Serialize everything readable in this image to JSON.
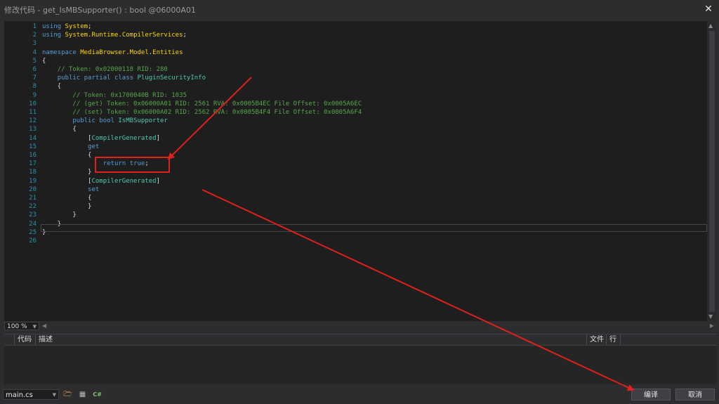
{
  "window": {
    "title": "修改代码 - get_IsMBSupporter() : bool @06000A01",
    "close_label": "✕"
  },
  "editor": {
    "lines": [
      {
        "num": "1",
        "parts": [
          [
            "kw",
            "using"
          ],
          [
            "plain",
            " "
          ],
          [
            "nm",
            "System"
          ],
          [
            "plain",
            ";"
          ]
        ]
      },
      {
        "num": "2",
        "parts": [
          [
            "kw",
            "using"
          ],
          [
            "plain",
            " "
          ],
          [
            "nm",
            "System"
          ],
          [
            "plain",
            "."
          ],
          [
            "nm",
            "Runtime"
          ],
          [
            "plain",
            "."
          ],
          [
            "nm",
            "CompilerServices"
          ],
          [
            "plain",
            ";"
          ]
        ]
      },
      {
        "num": "3",
        "parts": []
      },
      {
        "num": "4",
        "parts": [
          [
            "kw",
            "namespace"
          ],
          [
            "plain",
            " "
          ],
          [
            "nm",
            "MediaBrowser"
          ],
          [
            "plain",
            "."
          ],
          [
            "nm",
            "Model"
          ],
          [
            "plain",
            "."
          ],
          [
            "nm",
            "Entities"
          ]
        ]
      },
      {
        "num": "5",
        "parts": [
          [
            "plain",
            "{"
          ]
        ]
      },
      {
        "num": "6",
        "parts": [
          [
            "plain",
            "    "
          ],
          [
            "cm",
            "// Token: 0x02000118 RID: 280"
          ]
        ]
      },
      {
        "num": "7",
        "parts": [
          [
            "plain",
            "    "
          ],
          [
            "kw",
            "public partial class"
          ],
          [
            "plain",
            " "
          ],
          [
            "ty",
            "PluginSecurityInfo"
          ]
        ]
      },
      {
        "num": "8",
        "parts": [
          [
            "plain",
            "    {"
          ]
        ]
      },
      {
        "num": "9",
        "parts": [
          [
            "plain",
            "        "
          ],
          [
            "cm",
            "// Token: 0x1700040B RID: 1035"
          ]
        ]
      },
      {
        "num": "10",
        "parts": [
          [
            "plain",
            "        "
          ],
          [
            "cm",
            "// (get) Token: 0x06000A01 RID: 2561 RVA: 0x0005B4EC File Offset: 0x0005A6EC"
          ]
        ]
      },
      {
        "num": "11",
        "parts": [
          [
            "plain",
            "        "
          ],
          [
            "cm",
            "// (set) Token: 0x06000A02 RID: 2562 RVA: 0x0005B4F4 File Offset: 0x0005A6F4"
          ]
        ]
      },
      {
        "num": "12",
        "parts": [
          [
            "plain",
            "        "
          ],
          [
            "kw",
            "public bool"
          ],
          [
            "plain",
            " "
          ],
          [
            "ty",
            "IsMBSupporter"
          ]
        ]
      },
      {
        "num": "13",
        "parts": [
          [
            "plain",
            "        {"
          ]
        ]
      },
      {
        "num": "14",
        "parts": [
          [
            "plain",
            "            ["
          ],
          [
            "at",
            "CompilerGenerated"
          ],
          [
            "plain",
            "]"
          ]
        ]
      },
      {
        "num": "15",
        "parts": [
          [
            "plain",
            "            "
          ],
          [
            "kw",
            "get"
          ]
        ]
      },
      {
        "num": "16",
        "parts": [
          [
            "plain",
            "            {"
          ]
        ]
      },
      {
        "num": "17",
        "parts": [
          [
            "plain",
            "                "
          ],
          [
            "kw",
            "return true"
          ],
          [
            "plain",
            ";"
          ]
        ]
      },
      {
        "num": "18",
        "parts": [
          [
            "plain",
            "            }"
          ]
        ]
      },
      {
        "num": "19",
        "parts": [
          [
            "plain",
            "            ["
          ],
          [
            "at",
            "CompilerGenerated"
          ],
          [
            "plain",
            "]"
          ]
        ]
      },
      {
        "num": "20",
        "parts": [
          [
            "plain",
            "            "
          ],
          [
            "kw",
            "set"
          ]
        ]
      },
      {
        "num": "21",
        "parts": [
          [
            "plain",
            "            {"
          ]
        ]
      },
      {
        "num": "22",
        "parts": [
          [
            "plain",
            "            }"
          ]
        ]
      },
      {
        "num": "23",
        "parts": [
          [
            "plain",
            "        }"
          ]
        ]
      },
      {
        "num": "24",
        "parts": [
          [
            "plain",
            "    }"
          ]
        ]
      },
      {
        "num": "25",
        "parts": [
          [
            "plain",
            "}"
          ]
        ]
      },
      {
        "num": "26",
        "parts": []
      }
    ]
  },
  "zoom": {
    "value": "100 %"
  },
  "errors": {
    "columns": {
      "code": "代码",
      "description": "描述",
      "file": "文件",
      "line": "行"
    }
  },
  "footer": {
    "file_select": "main.cs",
    "compile_label": "编译",
    "cancel_label": "取消"
  },
  "colors": {
    "annotation": "#e0201c",
    "background": "#1e1e1e"
  }
}
